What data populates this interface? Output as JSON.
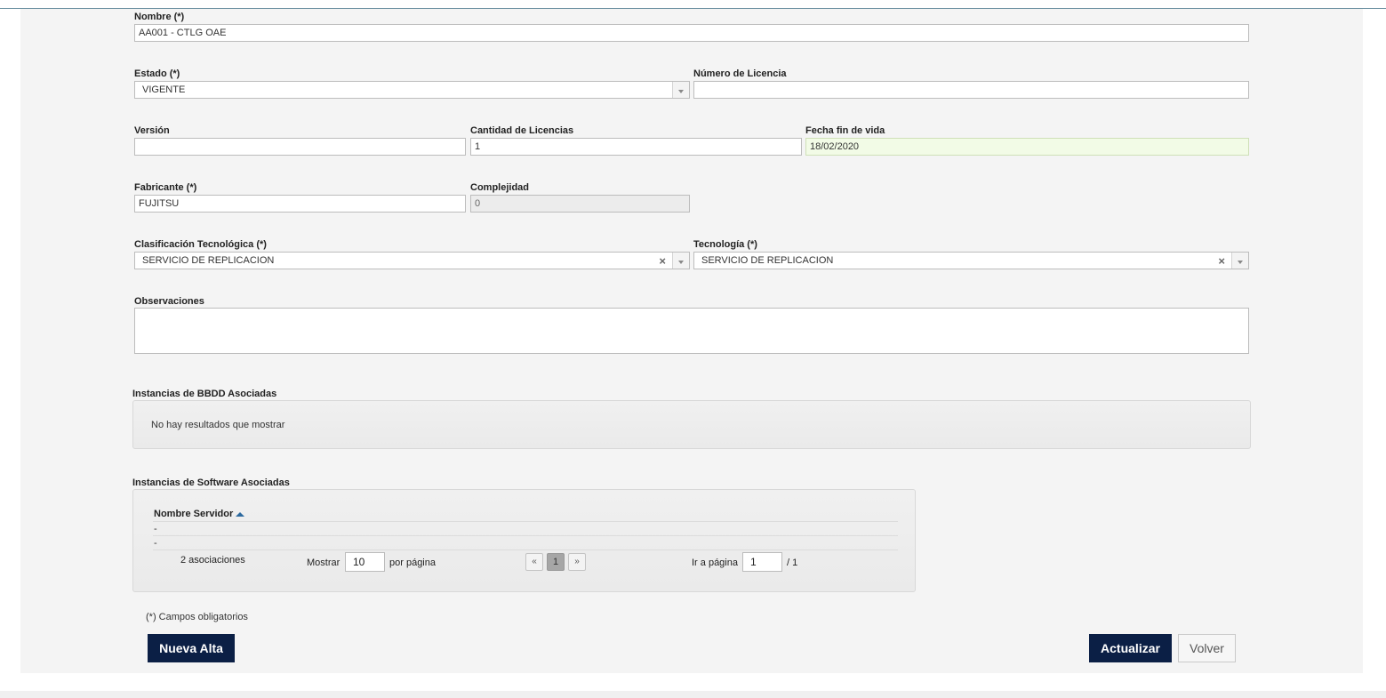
{
  "form": {
    "nombre": {
      "label": "Nombre (*)",
      "value": "AA001 - CTLG OAE"
    },
    "estado": {
      "label": "Estado (*)",
      "value": "VIGENTE"
    },
    "numero_licencia": {
      "label": "Número de Licencia",
      "value": ""
    },
    "version": {
      "label": "Versión",
      "value": ""
    },
    "cantidad_licencias": {
      "label": "Cantidad de Licencias",
      "value": "1"
    },
    "fecha_fin_vida": {
      "label": "Fecha fin de vida",
      "value": "18/02/2020"
    },
    "fabricante": {
      "label": "Fabricante (*)",
      "value": "FUJITSU"
    },
    "complejidad": {
      "label": "Complejidad",
      "value": "0"
    },
    "clasificacion": {
      "label": "Clasificación Tecnológica (*)",
      "value": "SERVICIO DE REPLICACION"
    },
    "tecnologia": {
      "label": "Tecnología (*)",
      "value": "SERVICIO DE REPLICACION"
    },
    "observaciones": {
      "label": "Observaciones",
      "value": ""
    }
  },
  "bbdd": {
    "title": "Instancias de BBDD Asociadas",
    "empty_message": "No hay resultados que mostrar"
  },
  "software": {
    "title": "Instancias de Software Asociadas",
    "column": "Nombre Servidor",
    "rows": [
      "-",
      "-"
    ],
    "count_label": "2 asociaciones",
    "show_label": "Mostrar",
    "per_page": "10",
    "per_page_label": "por página",
    "prev": "«",
    "current_page": "1",
    "next": "»",
    "goto_label": "Ir a página",
    "goto_value": "1",
    "total_pages": "/ 1"
  },
  "footer": {
    "required_note": "(*) Campos obligatorios",
    "nueva_alta": "Nueva Alta",
    "actualizar": "Actualizar",
    "volver": "Volver"
  },
  "icons": {
    "clear": "×",
    "sort": "sort-asc-icon",
    "dropdown": "chevron-down-icon"
  },
  "colors": {
    "primary_button": "#0b1f45",
    "date_field_bg": "#f2fbe6",
    "sort_arrow": "#2d6a9f"
  }
}
